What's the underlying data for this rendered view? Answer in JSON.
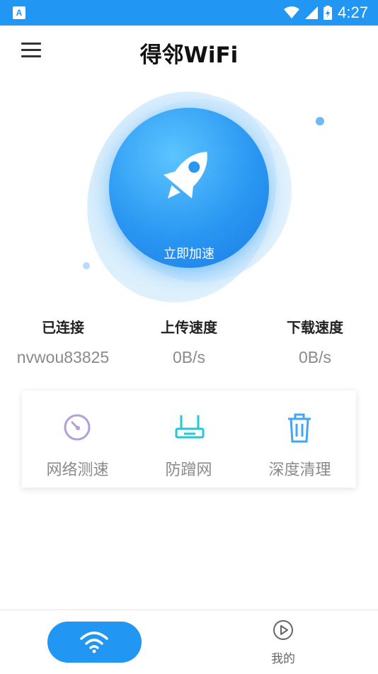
{
  "status_bar": {
    "time": "4:27",
    "app_badge": "A"
  },
  "app_bar": {
    "title": "得邻WiFi",
    "menu_icon": "menu-icon"
  },
  "boost": {
    "label": "立即加速",
    "icon": "rocket-icon"
  },
  "stats": [
    {
      "label": "已连接",
      "value": "nvwou83825"
    },
    {
      "label": "上传速度",
      "value": "0B/s"
    },
    {
      "label": "下载速度",
      "value": "0B/s"
    }
  ],
  "tools": [
    {
      "label": "网络测速",
      "icon": "speedometer-icon",
      "color": "#b39ddb"
    },
    {
      "label": "防蹭网",
      "icon": "router-icon",
      "color": "#26c6da"
    },
    {
      "label": "深度清理",
      "icon": "trash-icon",
      "color": "#42a5f5"
    }
  ],
  "bottom_nav": {
    "wifi_icon": "wifi-icon",
    "me_label": "我的",
    "me_icon": "play-circle-icon"
  },
  "colors": {
    "primary": "#2196f3",
    "text_gray": "#8a8a8a"
  }
}
